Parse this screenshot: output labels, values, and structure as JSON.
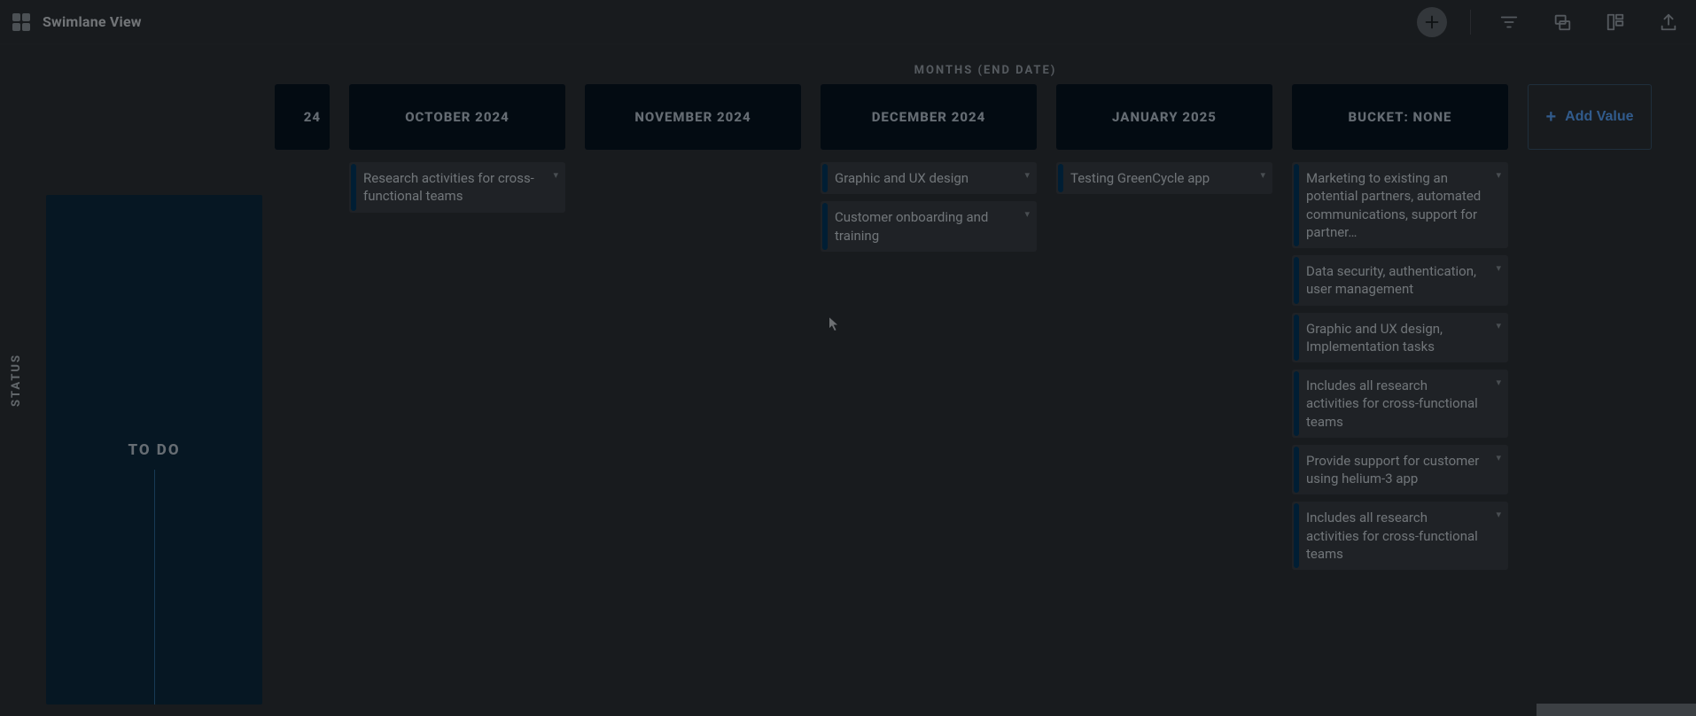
{
  "app": {
    "title": "Swimlane View"
  },
  "toolbar": {
    "add_label": "Add"
  },
  "axis_label": "MONTHS (END DATE)",
  "status_label": "STATUS",
  "lane_label": "TO DO",
  "add_value_label": "Add Value",
  "columns": [
    {
      "id": "sep24_partial",
      "header": "24",
      "partial": true,
      "cards": []
    },
    {
      "id": "oct24",
      "header": "OCTOBER 2024",
      "cards": [
        {
          "text": "Research activities for cross-functional teams"
        }
      ]
    },
    {
      "id": "nov24",
      "header": "NOVEMBER 2024",
      "cards": []
    },
    {
      "id": "dec24",
      "header": "DECEMBER 2024",
      "cards": [
        {
          "text": "Graphic and UX design"
        },
        {
          "text": "Customer onboarding and training"
        }
      ]
    },
    {
      "id": "jan25",
      "header": "JANUARY 2025",
      "cards": [
        {
          "text": "Testing GreenCycle app"
        }
      ]
    },
    {
      "id": "none",
      "header": "BUCKET: NONE",
      "cards": [
        {
          "text": "Marketing to existing an potential partners, automated communications, support for partner…"
        },
        {
          "text": "Data security, authentication, user management"
        },
        {
          "text": "Graphic and UX design, Implementation tasks"
        },
        {
          "text": "Includes all research activities for cross-functional teams"
        },
        {
          "text": "Provide support for customer using helium-3 app"
        },
        {
          "text": "Includes all research activities for cross-functional teams"
        }
      ]
    }
  ]
}
